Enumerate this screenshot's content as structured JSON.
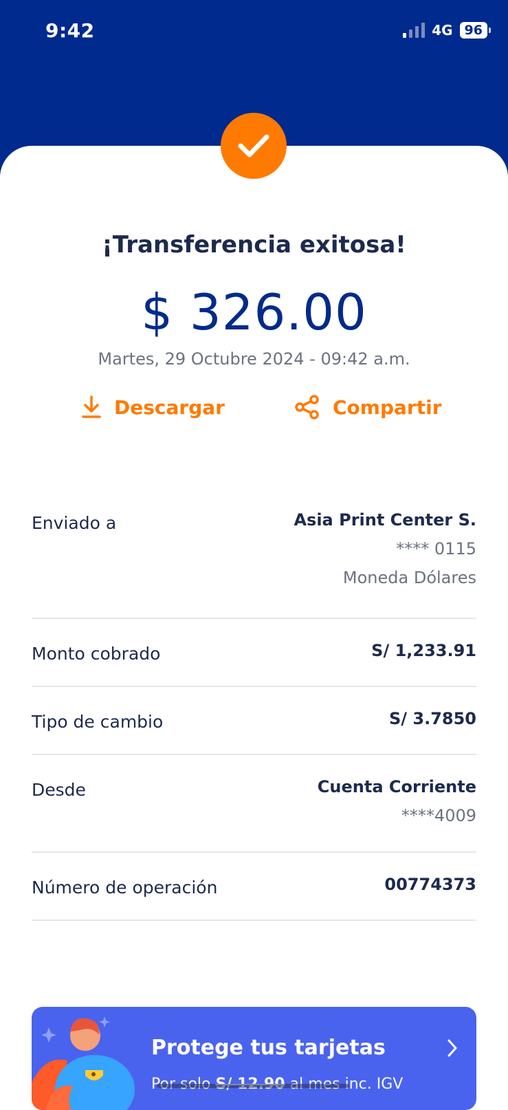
{
  "status_bar": {
    "time": "9:42",
    "network": "4G",
    "battery": "96"
  },
  "header": {
    "title": "¡Transferencia exitosa!",
    "amount": "$ 326.00",
    "datetime": "Martes, 29 Octubre 2024 - 09:42 a.m."
  },
  "actions": {
    "download_label": "Descargar",
    "share_label": "Compartir"
  },
  "details": [
    {
      "label": "Enviado a",
      "values": [
        "Asia Print Center S.",
        "**** 0115",
        "Moneda Dólares"
      ]
    },
    {
      "label": "Monto cobrado",
      "values": [
        "S/ 1,233.91"
      ]
    },
    {
      "label": "Tipo de cambio",
      "values": [
        "S/ 3.7850"
      ]
    },
    {
      "label": "Desde",
      "values": [
        "Cuenta Corriente",
        "****4009"
      ]
    },
    {
      "label": "Número de operación",
      "values": [
        "00774373"
      ]
    }
  ],
  "promo": {
    "title": "Protege tus tarjetas",
    "sub_prefix": "Por solo ",
    "sub_price": "S/ 12.90",
    "sub_suffix": " al mes inc. IGV"
  },
  "colors": {
    "brand_blue": "#002a8d",
    "accent_orange": "#ff7a00",
    "promo_blue": "#4a63ee"
  },
  "icons": [
    "checkmark-icon",
    "download-icon",
    "share-icon",
    "chevron-right-icon",
    "superhero-illustration"
  ]
}
